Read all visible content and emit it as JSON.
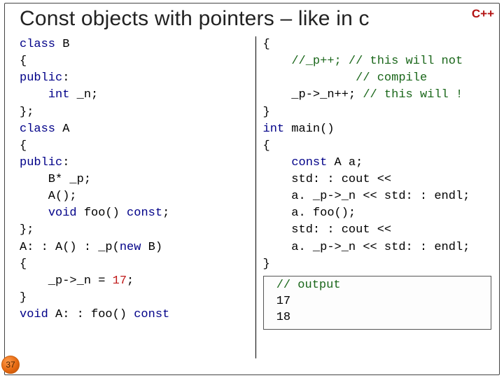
{
  "title": "Const objects with pointers – like in c",
  "lang_badge": "C++",
  "page_number": "37",
  "code_left": {
    "l01a": "class",
    "l01b": " B",
    "l02": "{",
    "l03": "public",
    "l03b": ":",
    "l04a": "    ",
    "l04b": "int",
    "l04c": " _n;",
    "l05": "};",
    "l06a": "class",
    "l06b": " A",
    "l07": "{",
    "l08": "public",
    "l08b": ":",
    "l09": "    B* _p;",
    "l10": "    A();",
    "l11a": "    ",
    "l11b": "void",
    "l11c": " foo() ",
    "l11d": "const",
    "l11e": ";",
    "l12": "};",
    "l13a": "A: : A() : _p(",
    "l13b": "new",
    "l13c": " B)",
    "l14": "{",
    "l15a": "    _p->_n = ",
    "l15b": "17",
    "l15c": ";",
    "l16": "}",
    "l17a": "void",
    "l17b": " A: : foo() ",
    "l17c": "const"
  },
  "code_right": {
    "r01": "{",
    "r02a": "    ",
    "r02b": "//_p++; // this will not",
    "r03a": "             ",
    "r03b": "// compile",
    "r04a": "    _p->_n++; ",
    "r04b": "// this will !",
    "r05": "}",
    "r06a": "int",
    "r06b": " main()",
    "r07": "{",
    "r08a": "    ",
    "r08b": "const",
    "r08c": " A a;",
    "r09": "    std: : cout <<",
    "r10": "    a. _p->_n << std: : endl;",
    "r11": "    a. foo();",
    "r12": "    std: : cout <<",
    "r13": "    a. _p->_n << std: : endl;",
    "r14": "}"
  },
  "output": {
    "label": " // output",
    "line1": " 17",
    "line2": " 18"
  }
}
